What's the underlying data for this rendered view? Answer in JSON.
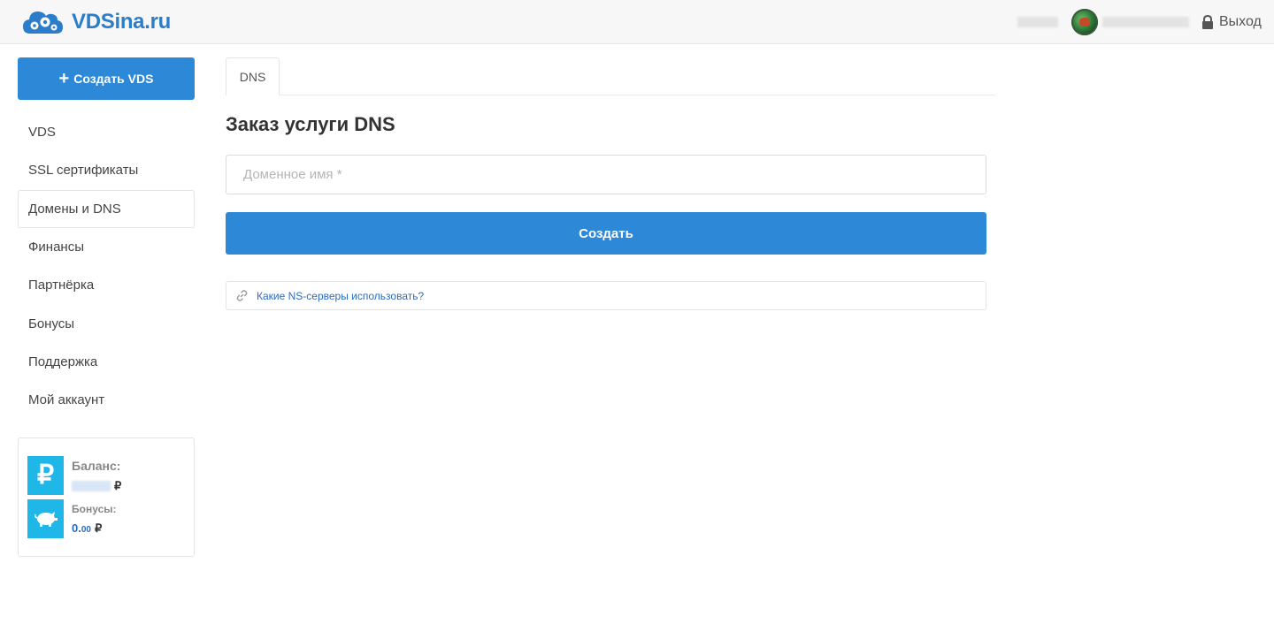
{
  "header": {
    "logo_text": "VDSina.ru",
    "logout_label": "Выход"
  },
  "sidebar": {
    "create_button_label": "Создать VDS",
    "items": [
      {
        "label": "VDS"
      },
      {
        "label": "SSL сертификаты"
      },
      {
        "label": "Домены и DNS",
        "active": true
      },
      {
        "label": "Финансы"
      },
      {
        "label": "Партнёрка"
      },
      {
        "label": "Бонусы"
      },
      {
        "label": "Поддержка"
      },
      {
        "label": "Мой аккаунт"
      }
    ],
    "balance": {
      "balance_label": "Баланс:",
      "currency": "₽",
      "bonus_label": "Бонусы:",
      "bonus_int": "0.",
      "bonus_dec": "00"
    }
  },
  "main": {
    "tab_label": "DNS",
    "title": "Заказ услуги DNS",
    "domain_placeholder": "Доменное имя *",
    "submit_label": "Создать",
    "ns_link_label": "Какие NS-серверы использовать?"
  },
  "colors": {
    "primary": "#2d88d8",
    "logo": "#2b7dc9",
    "link": "#2b6bc4",
    "balance_icon": "#1fb6e8"
  }
}
